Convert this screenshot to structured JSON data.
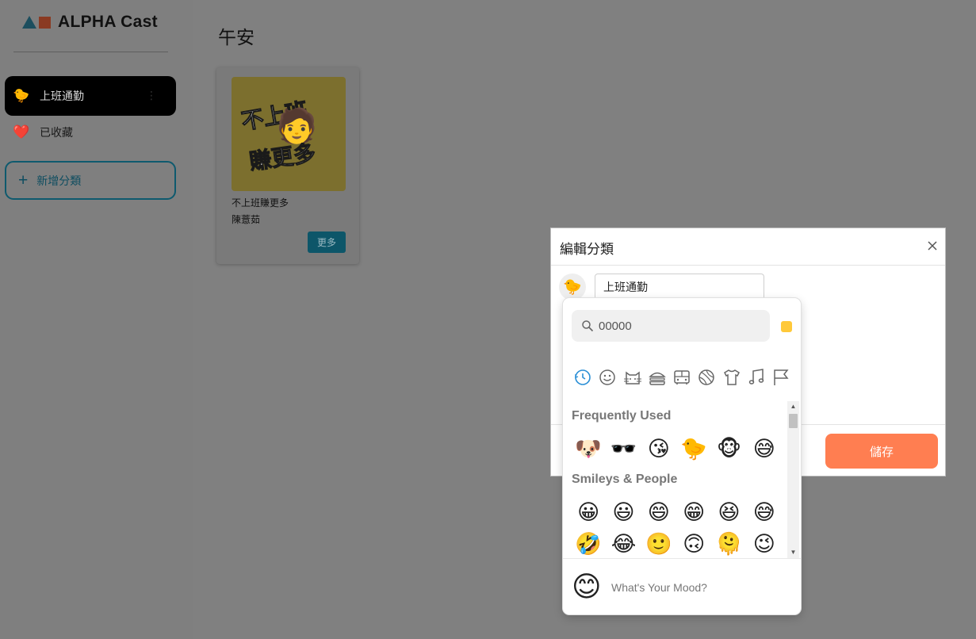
{
  "app": {
    "logo_text": "ALPHA Cast"
  },
  "sidebar": {
    "items": [
      {
        "emoji": "🐤",
        "label": "上班通勤",
        "menu_glyph": "⋮"
      },
      {
        "emoji": "❤️",
        "label": "已收藏"
      }
    ],
    "add_label": "新增分類",
    "add_glyph": "+"
  },
  "main": {
    "greeting": "午安",
    "cards": [
      {
        "cover_line1": "不上班",
        "cover_line2": "賺更多",
        "cover_figure": "🧑",
        "title": "不上班賺更多",
        "author": "陳薏茹",
        "more_label": "更多"
      }
    ]
  },
  "modal": {
    "title": "編輯分類",
    "emoji": "🐤",
    "input_value": "上班通勤",
    "save_label": "儲存"
  },
  "picker": {
    "search_value": "00000",
    "skin_color": "#ffc93a",
    "categories": [
      "clock-icon",
      "smiley-icon",
      "cat-icon",
      "burger-icon",
      "bus-icon",
      "ball-icon",
      "shirt-icon",
      "music-icon",
      "flag-icon"
    ],
    "groups": [
      {
        "label": "Frequently Used",
        "emojis": [
          "🐶",
          "🕶️",
          "😘",
          "🐤",
          "🐵",
          "😅"
        ]
      },
      {
        "label": "Smileys & People",
        "emojis": [
          "😀",
          "😃",
          "😄",
          "😁",
          "😆",
          "😅",
          "🤣",
          "😂",
          "🙂",
          "🙃",
          "🫠",
          "😉"
        ]
      }
    ],
    "footer_emoji": "😊",
    "footer_text": "What's Your Mood?"
  }
}
